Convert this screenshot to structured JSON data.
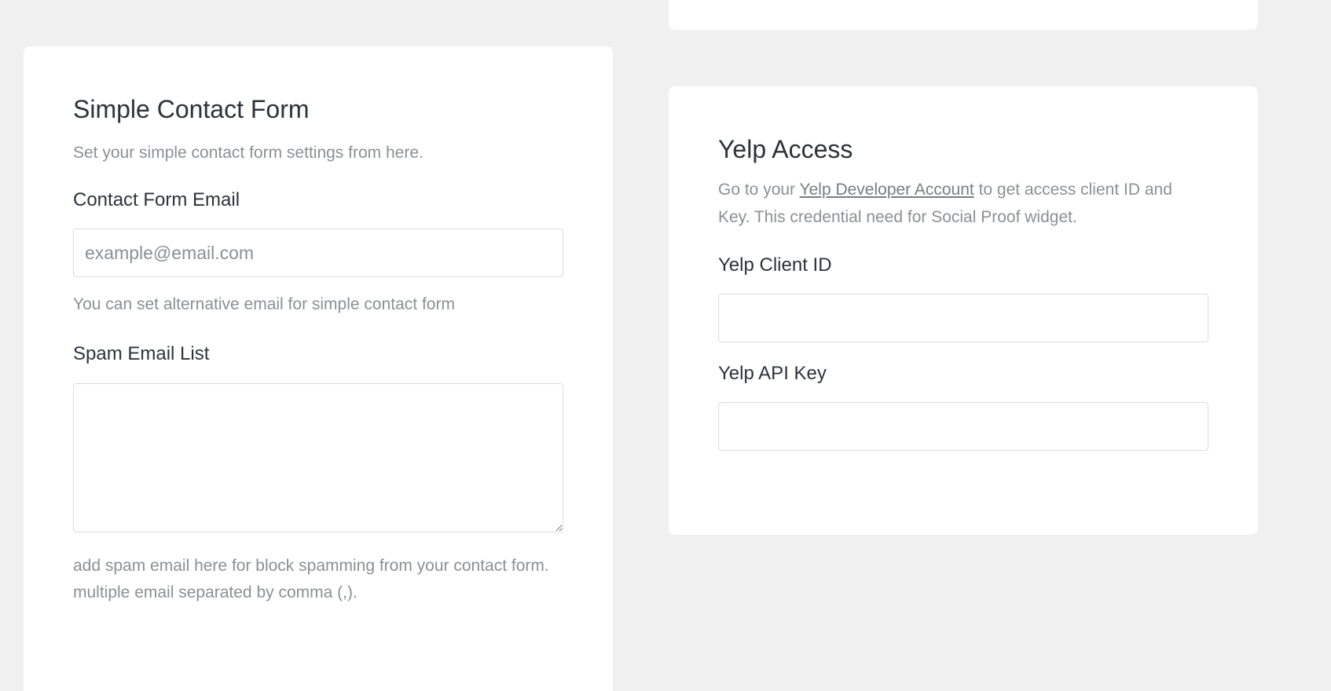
{
  "contact_card": {
    "title": "Simple Contact Form",
    "description": "Set your simple contact form settings from here.",
    "email_label": "Contact Form Email",
    "email_placeholder": "example@email.com",
    "email_value": "",
    "email_help": "You can set alternative email for simple contact form",
    "spam_label": "Spam Email List",
    "spam_value": "",
    "spam_help": "add spam email here for block spamming from your contact form. multiple email separated by comma (,)."
  },
  "yelp_card": {
    "title": "Yelp Access",
    "description_before_link": "Go to your ",
    "link_text": "Yelp Developer Account",
    "description_after_link": " to get access client ID and Key. This credential need for Social Proof widget.",
    "client_id_label": "Yelp Client ID",
    "client_id_value": "",
    "api_key_label": "Yelp API Key",
    "api_key_value": ""
  }
}
